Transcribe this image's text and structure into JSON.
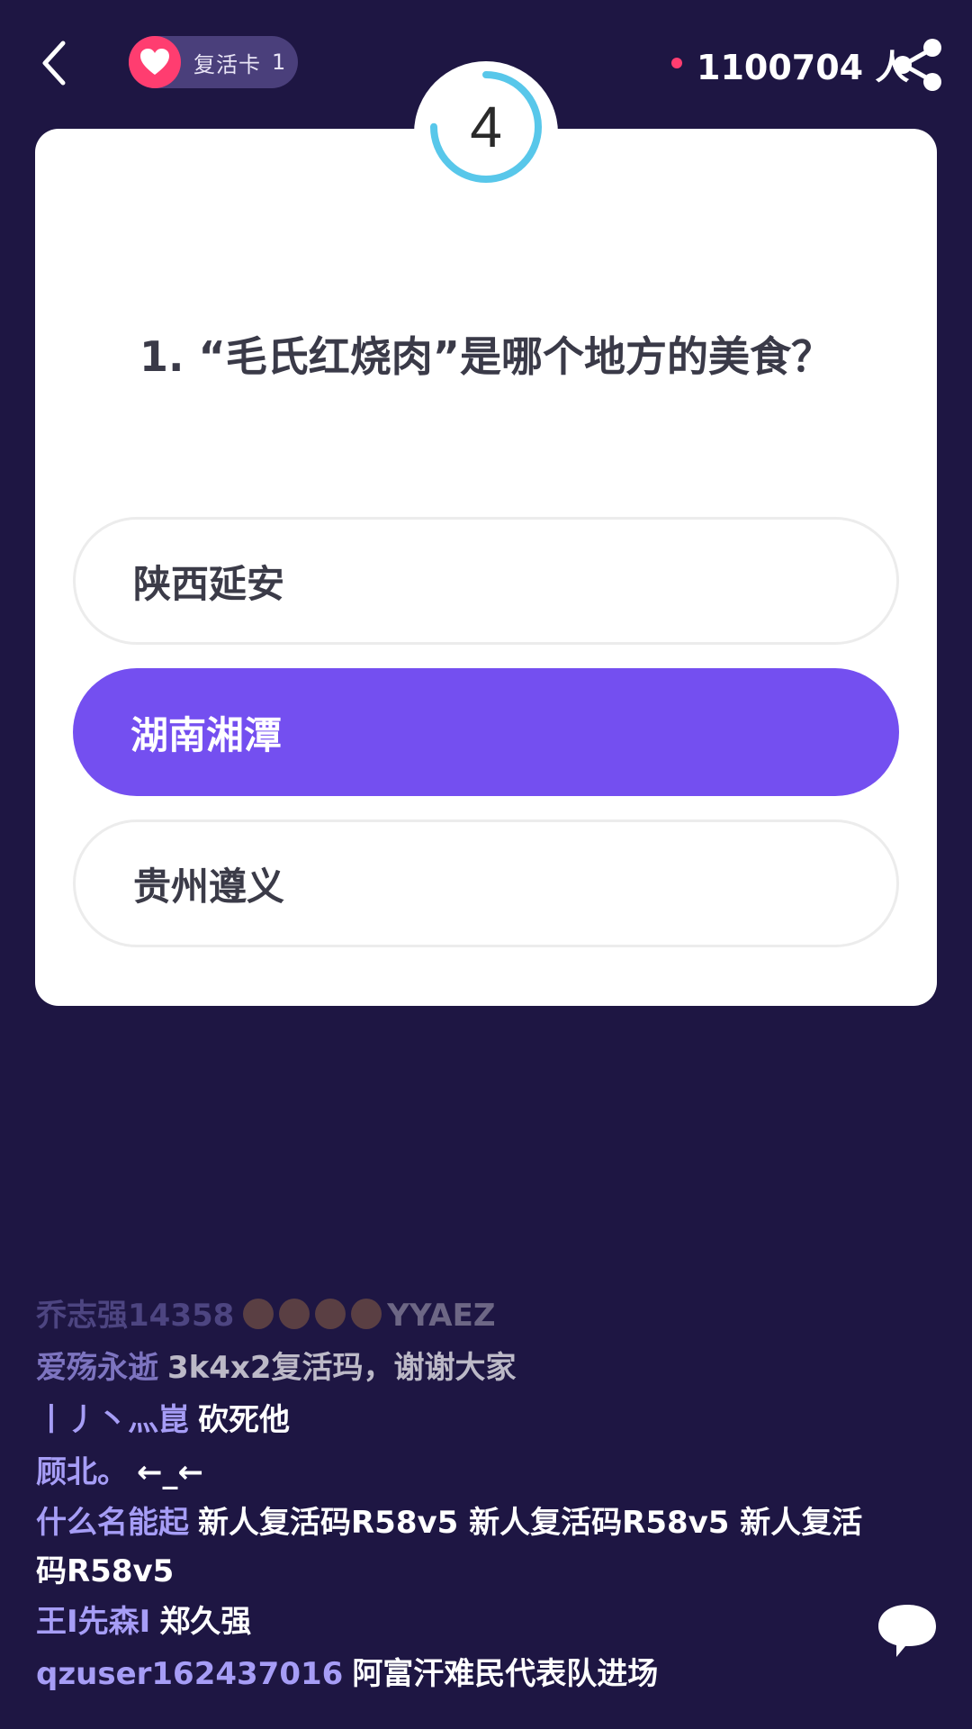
{
  "header": {
    "revive_label": "复活卡",
    "revive_count": "1",
    "online_count": "1100704 人"
  },
  "timer": {
    "value": "4",
    "progress": 0.75
  },
  "question": {
    "text": "1. “毛氏红烧肉”是哪个地方的美食？",
    "options": [
      {
        "label": "陕西延安",
        "selected": false
      },
      {
        "label": "湖南湘潭",
        "selected": true
      },
      {
        "label": "贵州遵义",
        "selected": false
      }
    ]
  },
  "chat": {
    "messages": [
      {
        "user": "乔志强14358",
        "text": "YYAEZ"
      },
      {
        "user": "爱殇永逝",
        "text": "3k4x2复活玛，谢谢大家"
      },
      {
        "user": "丨丿丶灬崑",
        "text": "砍死他"
      },
      {
        "user": "顾北。",
        "text": "←_←"
      },
      {
        "user": "什么名能起",
        "text": "新人复活码R58v5 新人复活码R58v5 新人复活码R58v5"
      },
      {
        "user": "王I先森I",
        "text": "郑久强"
      },
      {
        "user": "qzuser162437016",
        "text": "阿富汗难民代表队进场"
      }
    ]
  },
  "icons": {
    "back": "chevron-left-icon",
    "heart": "heart-icon",
    "share": "share-icon",
    "chat": "chat-bubble-icon"
  },
  "colors": {
    "background": "#1e1643",
    "accent": "#744ff0",
    "heart": "#ff3d70",
    "timer": "#58c7ea",
    "username": "#a69df6"
  }
}
